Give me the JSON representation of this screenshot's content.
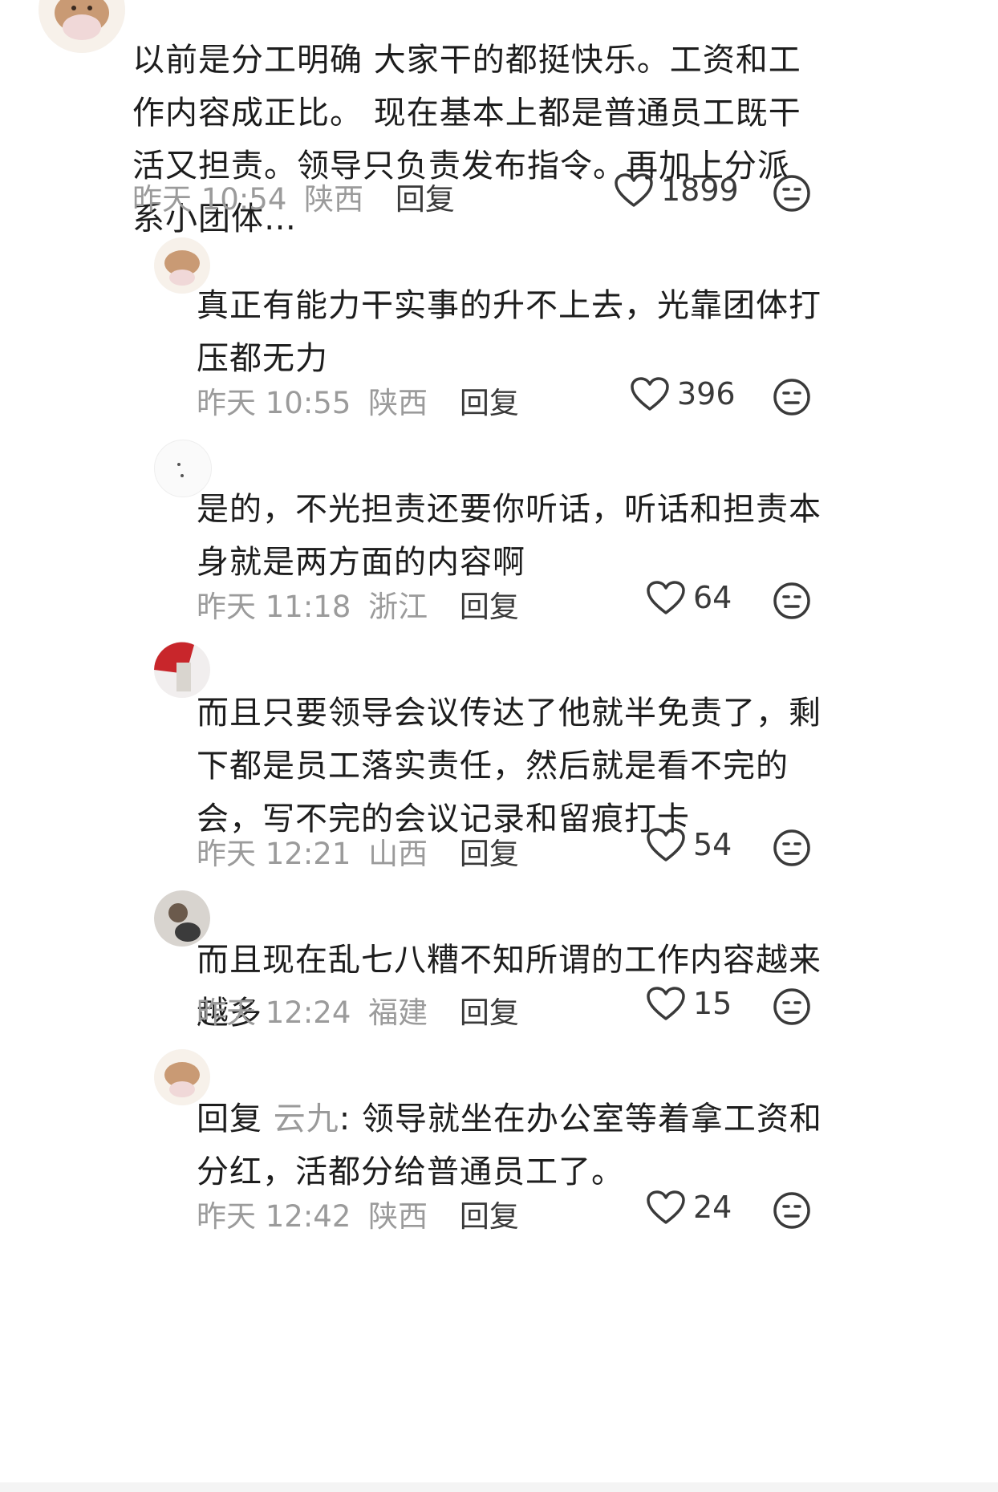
{
  "comments": [
    {
      "level": "top",
      "text": "以前是分工明确 大家干的都挺快乐。工资和工作内容成正比。 现在基本上都是普通员工既干活又担责。领导只负责发布指令。再加上分派系小团体…",
      "time": "昨天 10:54",
      "location": "陕西",
      "reply_label": "回复",
      "likes": "1899"
    },
    {
      "level": "reply",
      "text": "真正有能力干实事的升不上去，光靠团体打压都无力",
      "time": "昨天 10:55",
      "location": "陕西",
      "reply_label": "回复",
      "likes": "396"
    },
    {
      "level": "reply",
      "text": "是的，不光担责还要你听话，听话和担责本身就是两方面的内容啊",
      "time": "昨天 11:18",
      "location": "浙江",
      "reply_label": "回复",
      "likes": "64"
    },
    {
      "level": "reply",
      "text": "而且只要领导会议传达了他就半免责了，剩下都是员工落实责任，然后就是看不完的会，写不完的会议记录和留痕打卡",
      "time": "昨天 12:21",
      "location": "山西",
      "reply_label": "回复",
      "likes": "54"
    },
    {
      "level": "reply",
      "text": "而且现在乱七八糟不知所谓的工作内容越来越多",
      "time": "昨天 12:24",
      "location": "福建",
      "reply_label": "回复",
      "likes": "15"
    },
    {
      "level": "reply",
      "reply_prefix": "回复",
      "reply_to": "云九",
      "text": ": 领导就坐在办公室等着拿工资和分红，活都分给普通员工了。",
      "time": "昨天 12:42",
      "location": "陕西",
      "reply_label": "回复",
      "likes": "24"
    }
  ],
  "icons": {
    "like": "heart-outline-icon",
    "dislike": "meh-face-icon"
  },
  "colors": {
    "text": "#1d1d1d",
    "meta": "#9b9b9b",
    "reply_target": "#9a9a9a"
  }
}
